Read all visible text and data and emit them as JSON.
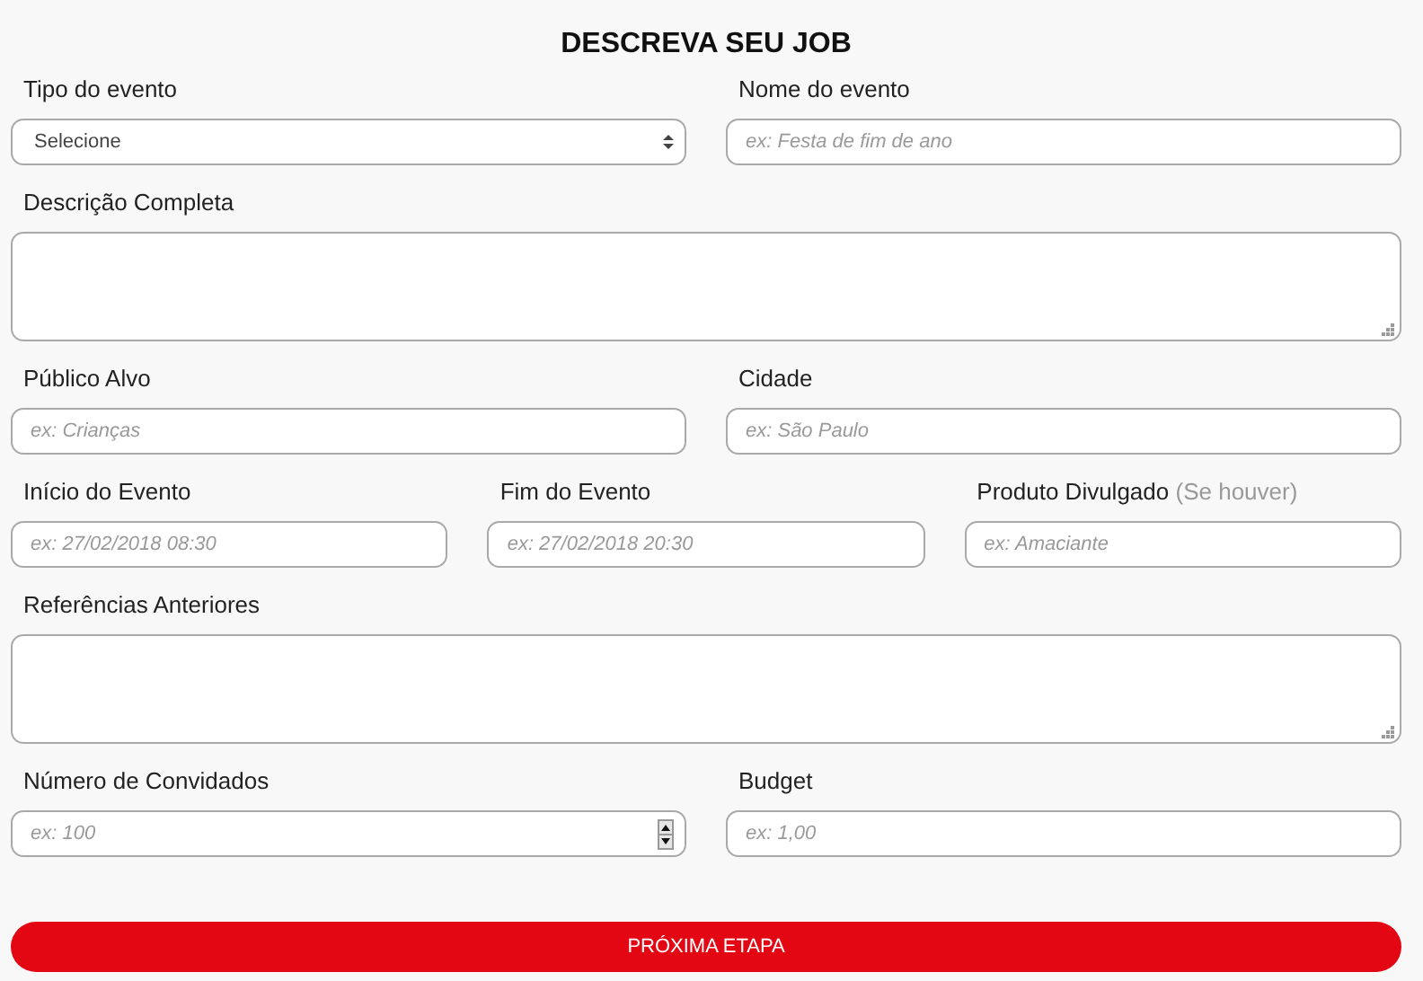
{
  "title": "DESCREVA SEU JOB",
  "rows": [
    {
      "fields": [
        {
          "kind": "select",
          "label": "Tipo do evento",
          "value": "Selecione"
        },
        {
          "kind": "text",
          "label": "Nome do evento",
          "placeholder": "ex: Festa de fim de ano"
        }
      ]
    },
    {
      "fields": [
        {
          "kind": "textarea",
          "label": "Descrição Completa"
        }
      ]
    },
    {
      "fields": [
        {
          "kind": "text",
          "label": "Público Alvo",
          "placeholder": "ex: Crianças"
        },
        {
          "kind": "text",
          "label": "Cidade",
          "placeholder": "ex: São Paulo"
        }
      ]
    },
    {
      "fields": [
        {
          "kind": "text",
          "label": "Início do Evento",
          "placeholder": "ex: 27/02/2018 08:30"
        },
        {
          "kind": "text",
          "label": "Fim do Evento",
          "placeholder": "ex: 27/02/2018 20:30"
        },
        {
          "kind": "text",
          "label": "Produto Divulgado",
          "hint": "(Se houver)",
          "placeholder": "ex: Amaciante"
        }
      ]
    },
    {
      "fields": [
        {
          "kind": "textarea",
          "label": "Referências Anteriores"
        }
      ]
    },
    {
      "fields": [
        {
          "kind": "number",
          "label": "Número de Convidados",
          "placeholder": "ex: 100"
        },
        {
          "kind": "text",
          "label": "Budget",
          "placeholder": "ex: 1,00"
        }
      ]
    }
  ],
  "button": "PRÓXIMA ETAPA"
}
